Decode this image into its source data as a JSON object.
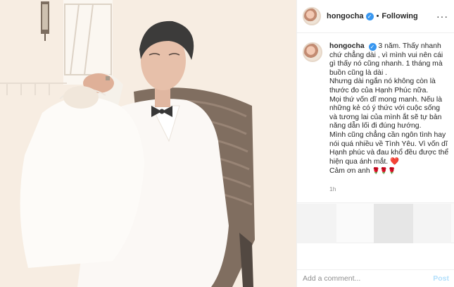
{
  "post": {
    "username": "hongocha",
    "verified_icon": "verified-badge-icon",
    "separator": "•",
    "follow_status": "Following",
    "more_icon": "more-options-icon",
    "more_glyph": "···"
  },
  "caption": {
    "username": "hongocha",
    "lines": [
      "3 năm. Thấy nhanh chứ chẳng dài , vì mình vui nên cái gì thấy nó cũng nhanh. 1 tháng mà buồn cũng là dài .",
      "Nhưng dài ngắn nó không còn là thước đo của Hạnh Phúc nữa.",
      "Mọi thứ vốn dĩ mong manh. Nếu là những kẻ có ý thức với cuộc sống và tương lai của mình ắt sẽ tự bản năng dẫn lối đi đúng hướng.",
      "Mình cũng chẳng cần ngôn tình hay nói quá nhiều về Tình Yêu. Vì vốn dĩ Hạnh phúc và đau khổ đều được thể hiện qua ánh mắt."
    ],
    "heart": "❤️",
    "closing": "Cảm ơn anh",
    "roses": "🌹🌹🌹",
    "time": "1h"
  },
  "comment": {
    "placeholder": "Add a comment...",
    "post_label": "Post"
  },
  "colors": {
    "accent": "#3897f0",
    "post_disabled": "#b2dffc",
    "muted": "#8e8e8e"
  }
}
